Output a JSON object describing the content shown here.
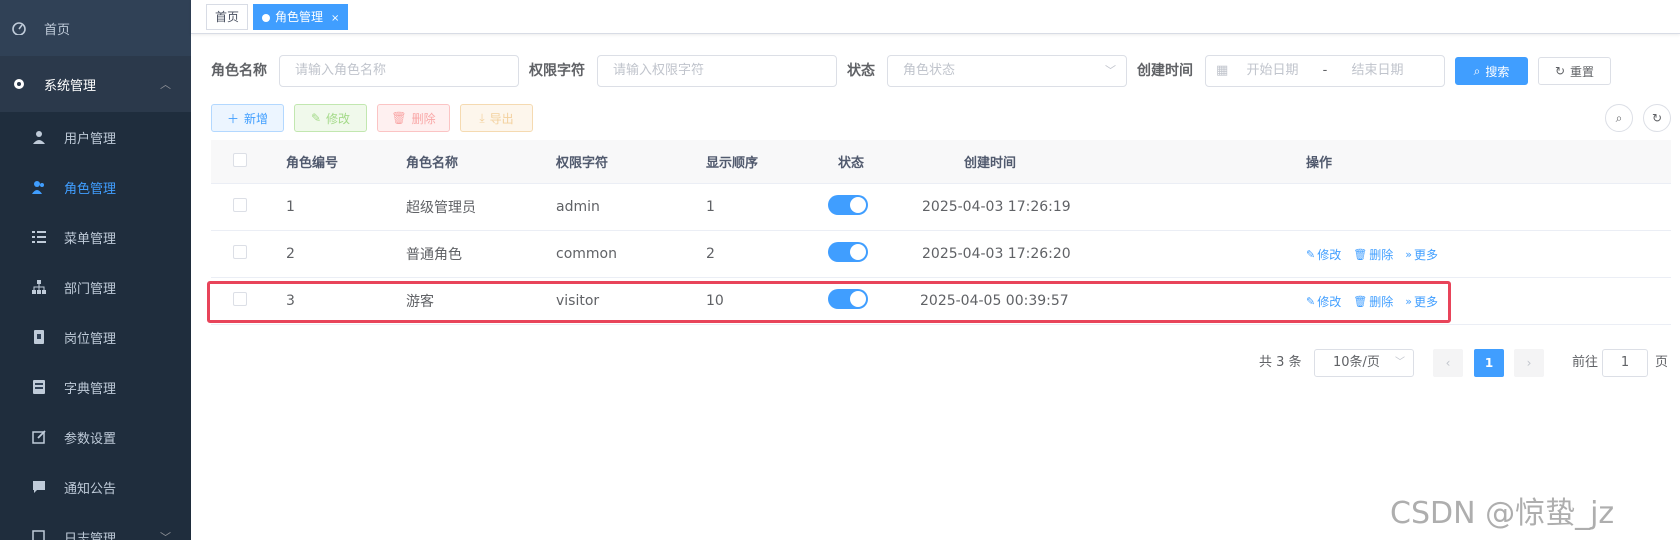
{
  "sidebar": {
    "home": {
      "label": "首页",
      "icon": "dashboard-icon"
    },
    "group": {
      "label": "系统管理",
      "icon": "gear-icon"
    },
    "items": [
      {
        "label": "用户管理",
        "icon": "user-icon"
      },
      {
        "label": "角色管理",
        "icon": "peoples-icon",
        "active": true
      },
      {
        "label": "菜单管理",
        "icon": "tree-table-icon"
      },
      {
        "label": "部门管理",
        "icon": "tree-icon"
      },
      {
        "label": "岗位管理",
        "icon": "post-icon"
      },
      {
        "label": "字典管理",
        "icon": "dict-icon"
      },
      {
        "label": "参数设置",
        "icon": "edit-icon"
      },
      {
        "label": "通知公告",
        "icon": "message-icon"
      },
      {
        "label": "日志管理",
        "icon": "log-icon"
      }
    ]
  },
  "tags": {
    "home": "首页",
    "active": "角色管理",
    "close": "×"
  },
  "search": {
    "role_name_label": "角色名称",
    "role_name_placeholder": "请输入角色名称",
    "perm_label": "权限字符",
    "perm_placeholder": "请输入权限字符",
    "status_label": "状态",
    "status_placeholder": "角色状态",
    "created_label": "创建时间",
    "start_placeholder": "开始日期",
    "range_sep": "-",
    "end_placeholder": "结束日期",
    "search_btn": "搜索",
    "reset_btn": "重置"
  },
  "toolbar": {
    "add": "新增",
    "edit": "修改",
    "delete": "删除",
    "export": "导出"
  },
  "table": {
    "headers": {
      "id": "角色编号",
      "name": "角色名称",
      "key": "权限字符",
      "sort": "显示顺序",
      "status": "状态",
      "created": "创建时间",
      "ops": "操作"
    },
    "rows": [
      {
        "id": "1",
        "name": "超级管理员",
        "key": "admin",
        "sort": "1",
        "status": true,
        "created": "2025-04-03 17:26:19",
        "ops": false
      },
      {
        "id": "2",
        "name": "普通角色",
        "key": "common",
        "sort": "2",
        "status": true,
        "created": "2025-04-03 17:26:20",
        "ops": true
      },
      {
        "id": "3",
        "name": "游客",
        "key": "visitor",
        "sort": "10",
        "status": true,
        "created": "2025-04-05 00:39:57",
        "ops": true
      }
    ],
    "op_labels": {
      "edit": "修改",
      "delete": "删除",
      "more": "更多"
    }
  },
  "pagination": {
    "total": "共 3 条",
    "page_size": "10条/页",
    "current": "1",
    "goto_label": "前往",
    "goto_value": "1",
    "page_unit": "页"
  },
  "watermark": "CSDN @惊蛰_jz",
  "colors": {
    "sidebar": "#304156",
    "primary": "#409eff",
    "highlight": "#e8445a"
  }
}
